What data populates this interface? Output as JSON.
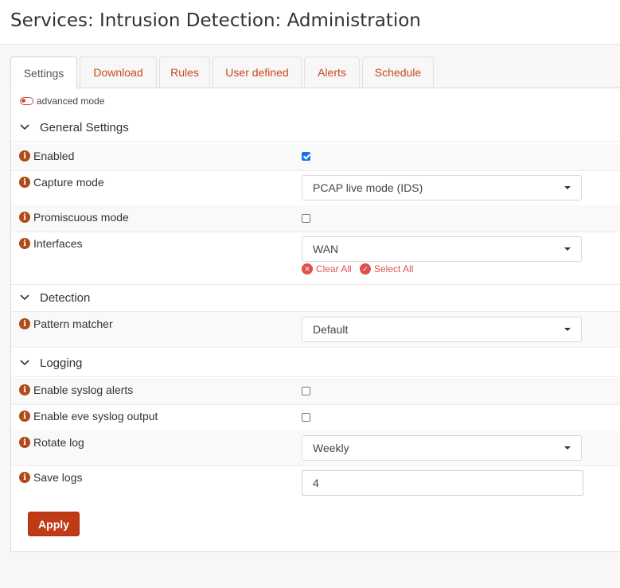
{
  "page": {
    "title": "Services: Intrusion Detection: Administration"
  },
  "tabs": [
    {
      "label": "Settings",
      "active": true
    },
    {
      "label": "Download"
    },
    {
      "label": "Rules"
    },
    {
      "label": "User defined"
    },
    {
      "label": "Alerts"
    },
    {
      "label": "Schedule"
    }
  ],
  "advanced_mode": {
    "label": "advanced mode"
  },
  "sections": {
    "general": "General Settings",
    "detection": "Detection",
    "logging": "Logging"
  },
  "fields": {
    "enabled": {
      "label": "Enabled",
      "checked": true
    },
    "capture_mode": {
      "label": "Capture mode",
      "value": "PCAP live mode (IDS)"
    },
    "promiscuous_mode": {
      "label": "Promiscuous mode",
      "checked": false
    },
    "interfaces": {
      "label": "Interfaces",
      "value": "WAN",
      "clear_all": "Clear All",
      "select_all": "Select All"
    },
    "pattern_matcher": {
      "label": "Pattern matcher",
      "value": "Default"
    },
    "syslog_alerts": {
      "label": "Enable syslog alerts",
      "checked": false
    },
    "eve_syslog": {
      "label": "Enable eve syslog output",
      "checked": false
    },
    "rotate_log": {
      "label": "Rotate log",
      "value": "Weekly"
    },
    "save_logs": {
      "label": "Save logs",
      "value": "4"
    }
  },
  "buttons": {
    "apply": "Apply"
  },
  "colors": {
    "accent": "#c03a16",
    "info_icon": "#b2491a",
    "checkbox": "#1a73e8"
  }
}
